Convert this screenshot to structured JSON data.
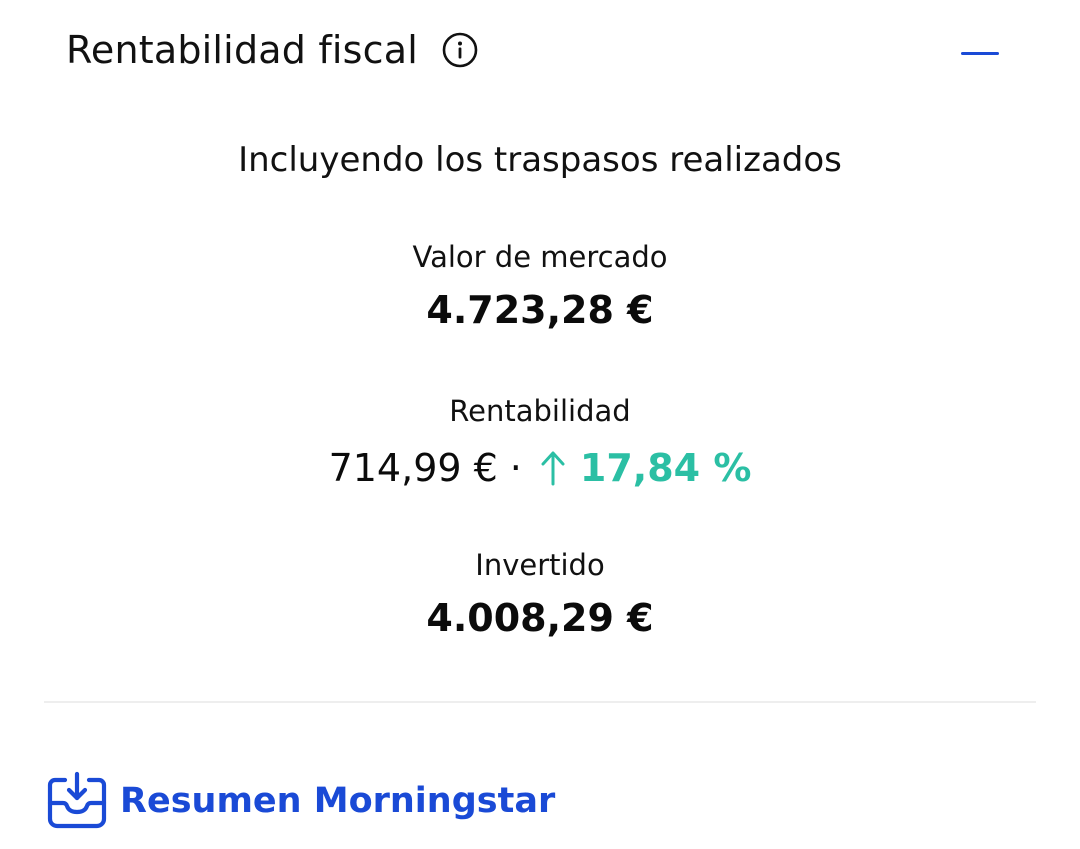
{
  "header": {
    "title": "Rentabilidad fiscal",
    "info_icon": "info-circle-icon",
    "collapse_icon": "minus-icon"
  },
  "subtitle": "Incluyendo los traspasos realizados",
  "metrics": {
    "market_value": {
      "label": "Valor de mercado",
      "value": "4.723,28 €"
    },
    "return": {
      "label": "Rentabilidad",
      "amount": "714,99 €",
      "separator": "·",
      "direction_icon": "arrow-up-icon",
      "percent": "17,84 %"
    },
    "invested": {
      "label": "Invertido",
      "value": "4.008,29 €"
    }
  },
  "footer": {
    "link_label": "Resumen Morningstar",
    "icon": "download-tray-icon"
  },
  "colors": {
    "accent": "#1a4ad6",
    "positive": "#2bbfa4",
    "text": "#111111",
    "divider": "#eeeeee"
  }
}
